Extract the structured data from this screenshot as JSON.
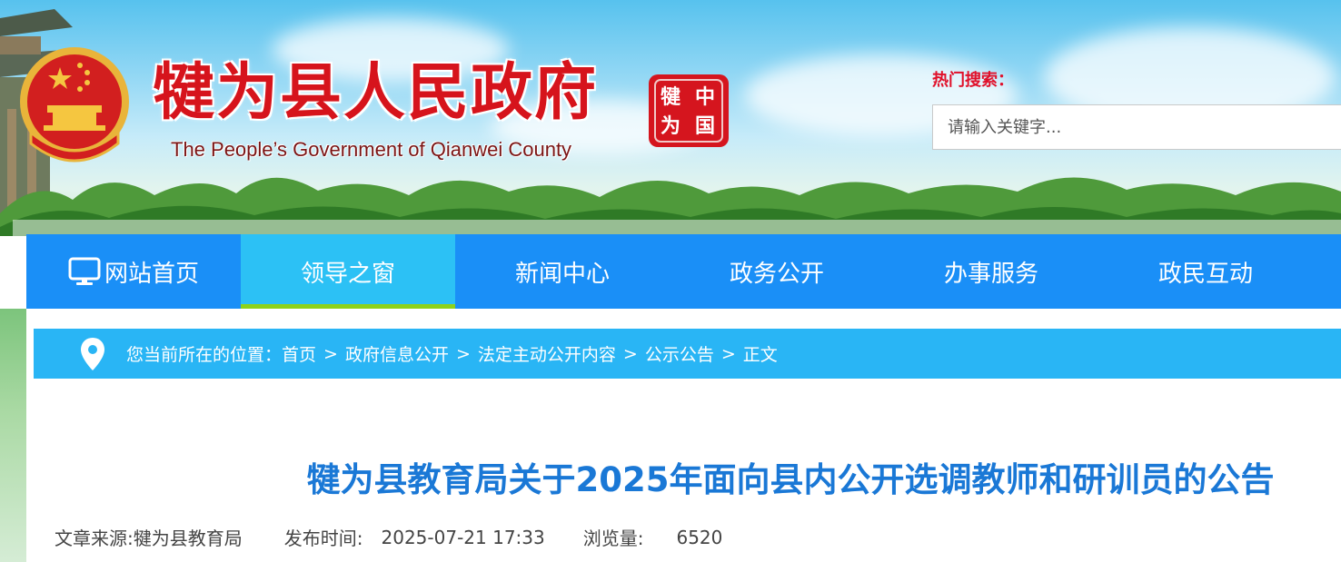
{
  "header": {
    "site_title": "犍为县人民政府",
    "site_subtitle": "The People’s Government of Qianwei County",
    "seal_chars": [
      "犍",
      "中",
      "为",
      "国"
    ],
    "hot_search_label": "热门搜索：",
    "search_placeholder": "请输入关键字..."
  },
  "nav": {
    "items": [
      {
        "label": "网站首页",
        "icon": "monitor-icon",
        "active": false
      },
      {
        "label": "领导之窗",
        "active": true
      },
      {
        "label": "新闻中心",
        "active": false
      },
      {
        "label": "政务公开",
        "active": false
      },
      {
        "label": "办事服务",
        "active": false
      },
      {
        "label": "政民互动",
        "active": false
      }
    ]
  },
  "breadcrumb": {
    "prefix": "您当前所在的位置：",
    "items": [
      "首页",
      "政府信息公开",
      "法定主动公开内容",
      "公示公告",
      "正文"
    ],
    "separator": ">"
  },
  "article": {
    "title": "犍为县教育局关于2025年面向县内公开选调教师和研训员的公告",
    "source_label": "文章来源:",
    "source_value": "犍为县教育局",
    "time_label": "发布时间:",
    "time_value": "2025-07-21 17:33",
    "views_label": "浏览量:",
    "views_value": "6520"
  },
  "colors": {
    "nav_bg": "#1a8ff7",
    "nav_active": "#2cc1f5",
    "nav_active_underline": "#8dd21a",
    "breadcrumb_bg": "#29b5f5",
    "title_red": "#d6141c",
    "article_title": "#1a78d6"
  }
}
